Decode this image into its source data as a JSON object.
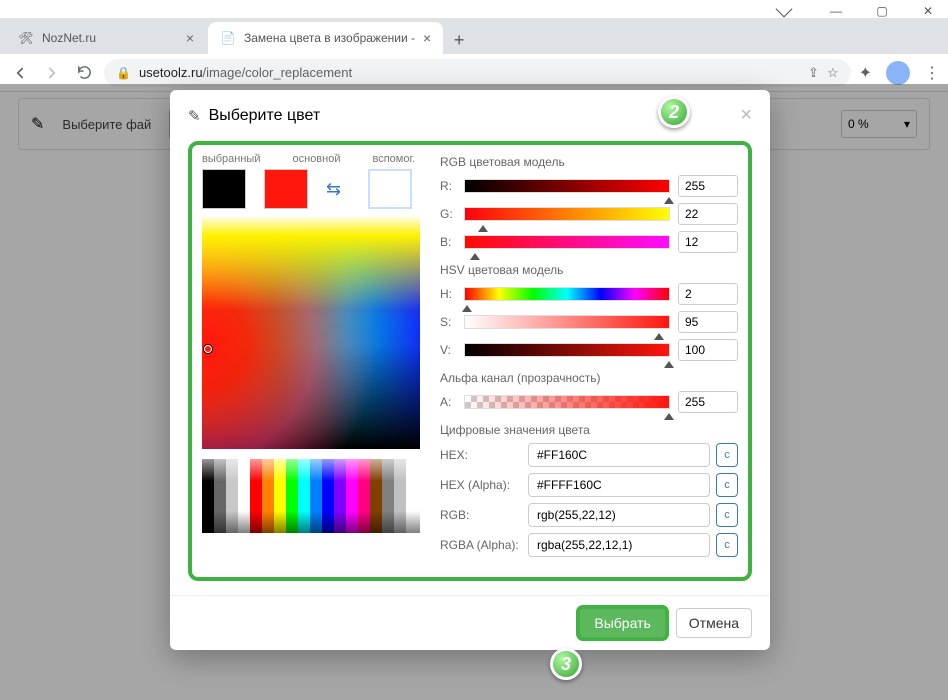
{
  "window": {
    "min": "—",
    "max": "▢",
    "close": "✕"
  },
  "tabs": [
    {
      "title": "NozNet.ru",
      "favicon": "🛠"
    },
    {
      "title": "Замена цвета в изображении -",
      "favicon": "📄"
    }
  ],
  "url": {
    "host": "usetoolz.ru",
    "path": "/image/color_replacement"
  },
  "underbar": {
    "file_label": "Выберите фай",
    "percent": "0 %"
  },
  "modal": {
    "title": "Выберите цвет",
    "labels": {
      "selected": "выбранный",
      "primary": "основной",
      "secondary": "вспомог."
    },
    "sections": {
      "rgb": "RGB цветовая модель",
      "hsv": "HSV цветовая модель",
      "alpha": "Альфа канал (прозрачность)",
      "digital": "Цифровые значения цвета"
    },
    "rgb": {
      "R": "255",
      "G": "22",
      "B": "12"
    },
    "hsv": {
      "H": "2",
      "S": "95",
      "V": "100"
    },
    "alpha": {
      "A": "255"
    },
    "hex": {
      "label": "HEX:",
      "value": "#FF160C"
    },
    "hexa": {
      "label": "HEX (Alpha):",
      "value": "#FFFF160C"
    },
    "rgb_txt": {
      "label": "RGB:",
      "value": "rgb(255,22,12)"
    },
    "rgba_txt": {
      "label": "RGBA (Alpha):",
      "value": "rgba(255,22,12,1)"
    },
    "copy": "c",
    "ok": "Выбрать",
    "cancel": "Отмена"
  },
  "badges": {
    "two": "2",
    "three": "3"
  }
}
